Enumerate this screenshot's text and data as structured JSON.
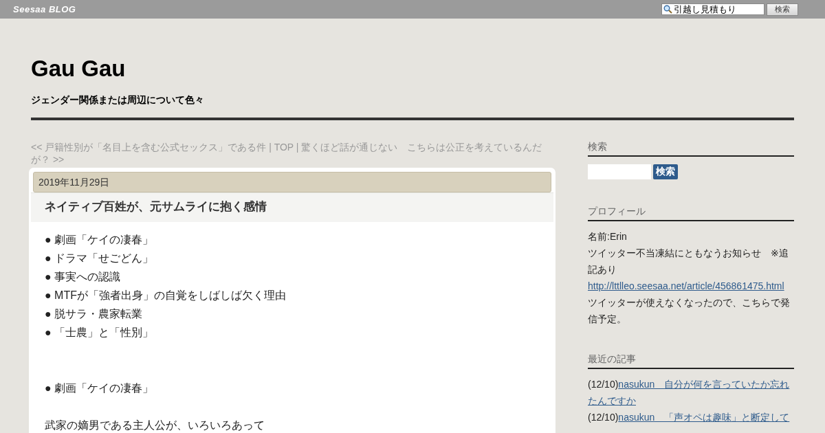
{
  "topbar": {
    "logo": "Seesaa BLOG",
    "search_value": "引越し見積もり",
    "search_button": "検索"
  },
  "blog": {
    "title": "Gau Gau",
    "subtitle": "ジェンダー関係または周辺について色々"
  },
  "nav": {
    "prev": "<< 戸籍性別が「名目上を含む公式セックス」である件",
    "separator_1": "|",
    "top": "TOP",
    "separator_2": "|",
    "next": "驚くほど話が通じない　こちらは公正を考えているんだが？ >>"
  },
  "article": {
    "date": "2019年11月29日",
    "title": "ネイティブ百姓が、元サムライに抱く感情",
    "toc": [
      "● 劇画「ケイの凄春」",
      "● ドラマ「せごどん」",
      "● 事実への認識",
      "● MTFが「強者出身」の自覚をしばしば欠く理由",
      "● 脱サラ・農家転業",
      "● 「士農」と「性別」"
    ],
    "section_heading": "● 劇画「ケイの凄春」",
    "paragraph": "武家の嫡男である主人公が、いろいろあって"
  },
  "sidebar": {
    "search": {
      "heading": "検索",
      "button": "検索"
    },
    "profile": {
      "heading": "プロフィール",
      "name": "名前:Erin",
      "notice": "ツイッター不当凍結にともなうお知らせ　※追記あり",
      "link": "http://lttlleo.seesaa.net/article/456861475.html",
      "note": "ツイッターが使えなくなったので、こちらで発信予定。"
    },
    "recent": {
      "heading": "最近の記事",
      "items": [
        {
          "date": "(12/10)",
          "title": "nasukun　自分が何を言っていたか忘れたんですか"
        },
        {
          "date": "(12/10)",
          "title": "nasukun　「声オペは趣味」と断定して"
        }
      ]
    }
  }
}
